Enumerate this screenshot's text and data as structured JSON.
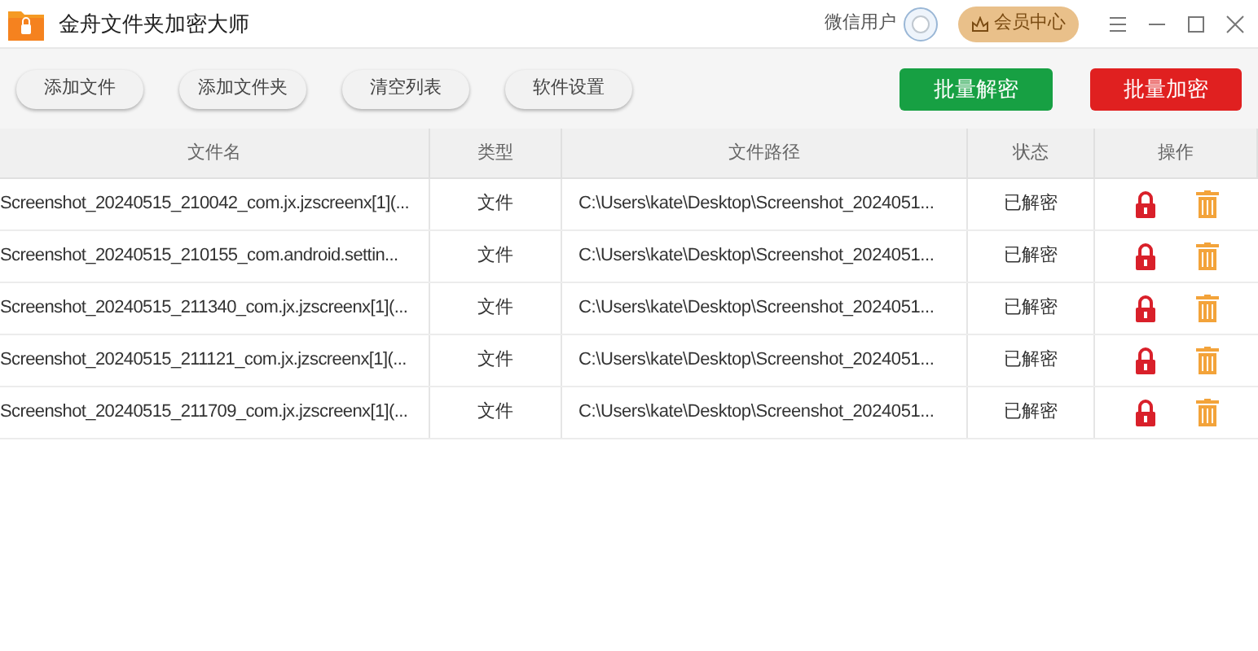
{
  "window": {
    "title": "金舟文件夹加密大师",
    "user": "微信用户",
    "vip_button": "会员中心"
  },
  "toolbar": {
    "buttons": [
      "添加文件",
      "添加文件夹",
      "清空列表",
      "软件设置"
    ],
    "decrypt_button": "批量解密",
    "encrypt_button": "批量加密"
  },
  "table": {
    "columns": [
      "文件名",
      "类型",
      "文件路径",
      "状态",
      "操作"
    ],
    "rows": [
      {
        "name": "Screenshot_20240515_210042_com.jx.jzscreenx[1](...",
        "type": "文件",
        "path": "C:\\Users\\kate\\Desktop\\Screenshot_2024051...",
        "status": "已解密"
      },
      {
        "name": "Screenshot_20240515_210155_com.android.settin...",
        "type": "文件",
        "path": "C:\\Users\\kate\\Desktop\\Screenshot_2024051...",
        "status": "已解密"
      },
      {
        "name": "Screenshot_20240515_211340_com.jx.jzscreenx[1](...",
        "type": "文件",
        "path": "C:\\Users\\kate\\Desktop\\Screenshot_2024051...",
        "status": "已解密"
      },
      {
        "name": "Screenshot_20240515_211121_com.jx.jzscreenx[1](...",
        "type": "文件",
        "path": "C:\\Users\\kate\\Desktop\\Screenshot_2024051...",
        "status": "已解密"
      },
      {
        "name": "Screenshot_20240515_211709_com.jx.jzscreenx[1](...",
        "type": "文件",
        "path": "C:\\Users\\kate\\Desktop\\Screenshot_2024051...",
        "status": "已解密"
      }
    ]
  }
}
